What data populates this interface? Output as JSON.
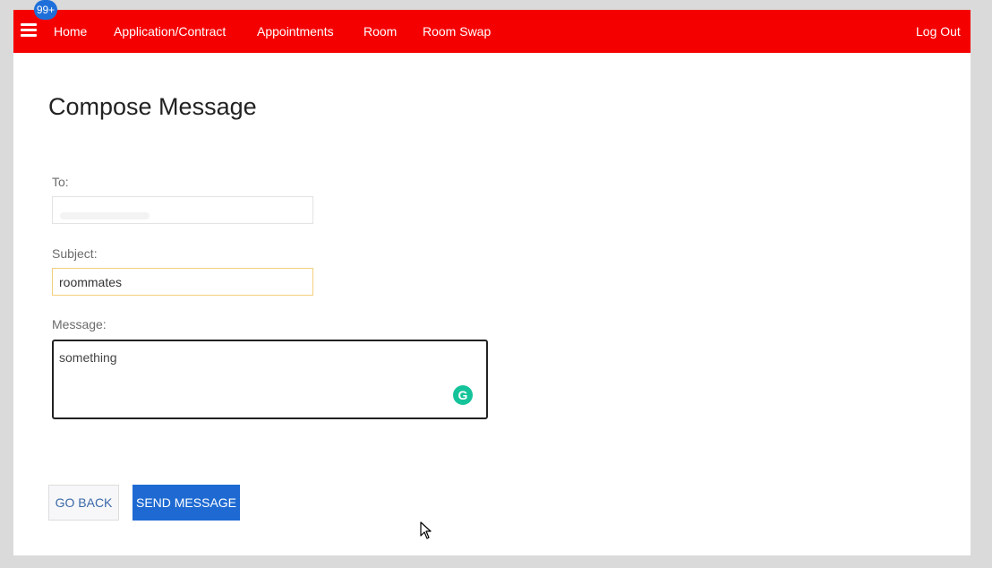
{
  "navbar": {
    "badge": "99+",
    "links": [
      "Home",
      "Application/Contract",
      "Appointments",
      "Room",
      "Room Swap"
    ],
    "logout": "Log Out",
    "color": "#f50000"
  },
  "page": {
    "title": "Compose Message"
  },
  "form": {
    "to_label": "To:",
    "to_value": "",
    "subject_label": "Subject:",
    "subject_value": "roommates",
    "message_label": "Message:",
    "message_value": "something"
  },
  "buttons": {
    "back": "GO BACK",
    "send": "SEND MESSAGE",
    "send_color": "#1e6ad2"
  },
  "icons": {
    "menu": "hamburger-menu-icon",
    "grammarly": "grammarly-icon",
    "cursor": "mouse-pointer-icon"
  }
}
